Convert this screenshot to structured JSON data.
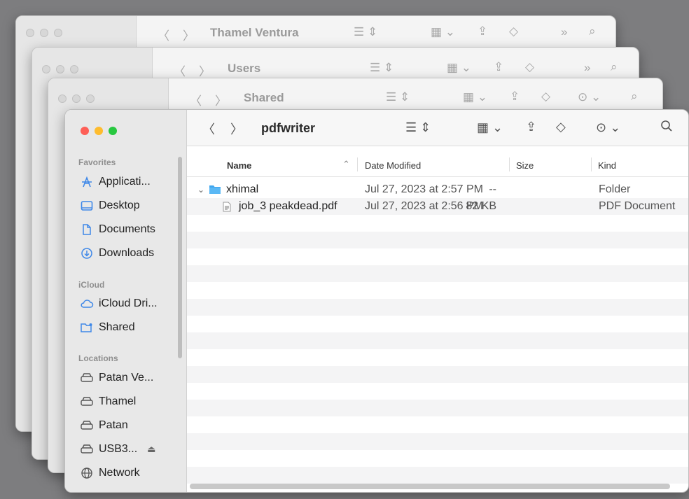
{
  "back_windows": [
    {
      "title": "Thamel Ventura"
    },
    {
      "title": "Users"
    },
    {
      "title": "Shared"
    }
  ],
  "main": {
    "title": "pdfwriter",
    "sidebar": {
      "favorites_header": "Favorites",
      "favorites": [
        {
          "label": "Applicati...",
          "icon": "applications-icon"
        },
        {
          "label": "Desktop",
          "icon": "desktop-icon"
        },
        {
          "label": "Documents",
          "icon": "documents-icon"
        },
        {
          "label": "Downloads",
          "icon": "downloads-icon"
        }
      ],
      "icloud_header": "iCloud",
      "icloud": [
        {
          "label": "iCloud Dri...",
          "icon": "icloud-icon"
        },
        {
          "label": "Shared",
          "icon": "shared-folder-icon"
        }
      ],
      "locations_header": "Locations",
      "locations": [
        {
          "label": "Patan Ve...",
          "icon": "disk-icon"
        },
        {
          "label": "Thamel",
          "icon": "disk-icon"
        },
        {
          "label": "Patan",
          "icon": "disk-icon"
        },
        {
          "label": "USB3...",
          "icon": "external-disk-icon",
          "eject": "⏏"
        },
        {
          "label": "Network",
          "icon": "network-icon"
        }
      ]
    },
    "columns": {
      "name": "Name",
      "date": "Date Modified",
      "size": "Size",
      "kind": "Kind"
    },
    "rows": [
      {
        "name": "xhimal",
        "date": "Jul 27, 2023 at 2:57 PM",
        "size": "--",
        "kind": "Folder"
      },
      {
        "name": "job_3 peakdead.pdf",
        "date": "Jul 27, 2023 at 2:56 PM",
        "size": "82 KB",
        "kind": "PDF Document"
      }
    ]
  },
  "colors": {
    "accent": "#3f88e8",
    "close": "#fe5f57",
    "minimize": "#febc2e",
    "zoom": "#28c840"
  }
}
